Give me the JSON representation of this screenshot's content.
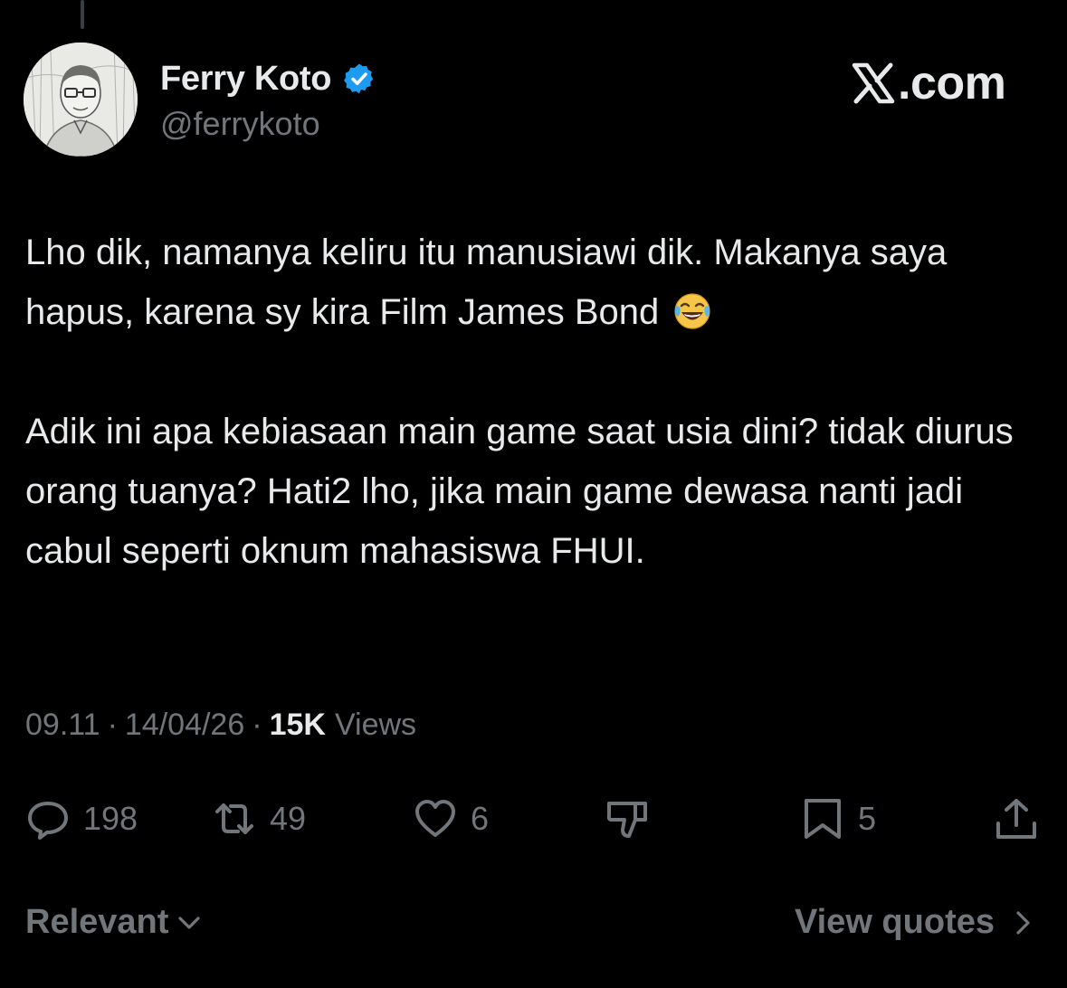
{
  "author": {
    "display_name": "Ferry Koto",
    "handle": "@ferrykoto",
    "verified": true
  },
  "brand": {
    "label": ".com",
    "icon": "x-logo-icon"
  },
  "tweet": {
    "paragraph_1": "Lho dik, namanya keliru itu manusiawi dik. Makanya saya hapus, karena sy kira Film James Bond",
    "paragraph_1_emoji": "face-with-tears-of-joy-emoji",
    "paragraph_2": "Adik ini apa kebiasaan main game saat usia dini? tidak diurus orang tuanya? Hati2 lho, jika main game dewasa nanti jadi cabul seperti oknum mahasiswa FHUI."
  },
  "meta": {
    "time": "09.11",
    "separator": "·",
    "date": "14/04/26",
    "views_count": "15K",
    "views_label": "Views"
  },
  "actions": {
    "replies": "198",
    "reposts": "49",
    "likes": "6",
    "bookmarks": "5"
  },
  "footer": {
    "sort_label": "Relevant",
    "quotes_label": "View quotes"
  },
  "colors": {
    "background": "#000000",
    "text_primary": "#e7e9ea",
    "text_secondary": "#71767b",
    "verified_badge": "#1d9bf0"
  }
}
